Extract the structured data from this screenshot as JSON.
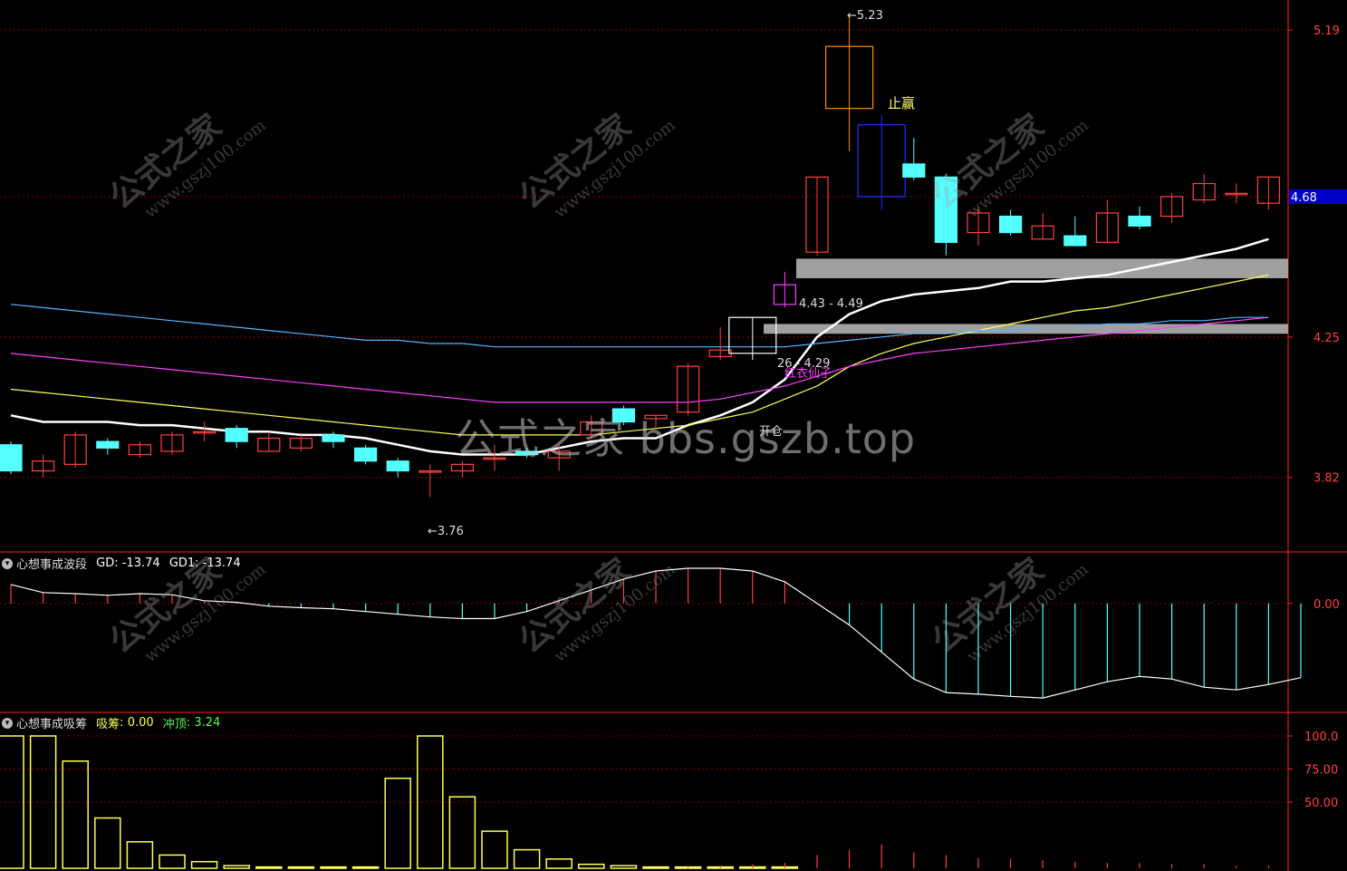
{
  "colors": {
    "up": "#ff4040",
    "down": "#54ffff",
    "ma_white": "#ffffff",
    "ma_yellow": "#ffff54",
    "ma_magenta": "#ff40ff",
    "ma_blue": "#54b4ff",
    "grid": "#8b0000",
    "axis": "#ff2020",
    "zone": "#a0a0a0",
    "osc_up": "#ff4040",
    "osc_down": "#54ffff",
    "bar_yellow": "#ffff54",
    "bar_red": "#ff4040"
  },
  "main_axis": {
    "ticks": [
      "5.19",
      "4.25",
      "3.82"
    ],
    "current_price": "4.68",
    "range": [
      3.6,
      5.26
    ]
  },
  "annotations": {
    "high": "5.23",
    "low": "3.76",
    "zone_upper": "4.43 - 4.49",
    "zone_lower": "26 - 4.29",
    "stop_profit": "止赢",
    "red_candle_label": "红衣仙子",
    "open_label": "开仓"
  },
  "watermark": {
    "main": "公式之家 bbs.gszb.top",
    "cn": "公式之家",
    "url": "www.gszj100.com"
  },
  "panel2": {
    "title": "心想事成波段",
    "gd_label": "GD: -13.74",
    "gd1_label": "GD1: -13.74",
    "zero_label": "0.00"
  },
  "panel3": {
    "title": "心想事成吸筹",
    "absorb_label": "吸筹",
    "absorb_value": "0.00",
    "top_label": "冲顶",
    "top_value": "3.24",
    "ticks": [
      "100.0",
      "75.00",
      "50.00"
    ]
  },
  "chart_data": [
    {
      "type": "candlestick",
      "title": "",
      "ylim": [
        3.6,
        5.26
      ],
      "candles": [
        {
          "o": 3.92,
          "c": 3.84,
          "h": 3.93,
          "l": 3.83
        },
        {
          "o": 3.84,
          "c": 3.87,
          "h": 3.89,
          "l": 3.82
        },
        {
          "o": 3.86,
          "c": 3.95,
          "h": 3.96,
          "l": 3.85
        },
        {
          "o": 3.93,
          "c": 3.91,
          "h": 3.94,
          "l": 3.89
        },
        {
          "o": 3.89,
          "c": 3.92,
          "h": 3.93,
          "l": 3.88
        },
        {
          "o": 3.9,
          "c": 3.95,
          "h": 3.96,
          "l": 3.89
        },
        {
          "o": 3.96,
          "c": 3.96,
          "h": 3.99,
          "l": 3.93
        },
        {
          "o": 3.97,
          "c": 3.93,
          "h": 3.98,
          "l": 3.91
        },
        {
          "o": 3.9,
          "c": 3.94,
          "h": 3.96,
          "l": 3.9
        },
        {
          "o": 3.91,
          "c": 3.94,
          "h": 3.95,
          "l": 3.9
        },
        {
          "o": 3.95,
          "c": 3.93,
          "h": 3.96,
          "l": 3.91
        },
        {
          "o": 3.91,
          "c": 3.87,
          "h": 3.92,
          "l": 3.86
        },
        {
          "o": 3.87,
          "c": 3.84,
          "h": 3.88,
          "l": 3.82
        },
        {
          "o": 3.84,
          "c": 3.84,
          "h": 3.86,
          "l": 3.76
        },
        {
          "o": 3.84,
          "c": 3.86,
          "h": 3.87,
          "l": 3.82
        },
        {
          "o": 3.88,
          "c": 3.88,
          "h": 3.92,
          "l": 3.84
        },
        {
          "o": 3.9,
          "c": 3.89,
          "h": 3.91,
          "l": 3.88
        },
        {
          "o": 3.88,
          "c": 3.9,
          "h": 3.92,
          "l": 3.84
        },
        {
          "o": 3.95,
          "c": 3.99,
          "h": 4.01,
          "l": 3.94
        },
        {
          "o": 4.03,
          "c": 3.99,
          "h": 4.04,
          "l": 3.98
        },
        {
          "o": 4.0,
          "c": 4.01,
          "h": 4.01,
          "l": 3.97
        },
        {
          "o": 4.02,
          "c": 4.16,
          "h": 4.17,
          "l": 4.01
        },
        {
          "o": 4.19,
          "c": 4.21,
          "h": 4.28,
          "l": 4.18
        },
        {
          "o": 4.2,
          "c": 4.31,
          "h": 4.31,
          "l": 4.18
        },
        {
          "o": 4.35,
          "c": 4.41,
          "h": 4.45,
          "l": 4.34
        },
        {
          "o": 4.51,
          "c": 4.74,
          "h": 4.74,
          "l": 4.5
        },
        {
          "o": 4.95,
          "c": 5.14,
          "h": 5.23,
          "l": 4.82
        },
        {
          "o": 4.68,
          "c": 4.9,
          "h": 4.93,
          "l": 4.64
        },
        {
          "o": 4.78,
          "c": 4.74,
          "h": 4.86,
          "l": 4.73
        },
        {
          "o": 4.74,
          "c": 4.54,
          "h": 4.75,
          "l": 4.5
        },
        {
          "o": 4.57,
          "c": 4.63,
          "h": 4.65,
          "l": 4.53
        },
        {
          "o": 4.62,
          "c": 4.57,
          "h": 4.64,
          "l": 4.56
        },
        {
          "o": 4.55,
          "c": 4.59,
          "h": 4.63,
          "l": 4.55
        },
        {
          "o": 4.56,
          "c": 4.53,
          "h": 4.62,
          "l": 4.53
        },
        {
          "o": 4.54,
          "c": 4.63,
          "h": 4.67,
          "l": 4.54
        },
        {
          "o": 4.62,
          "c": 4.59,
          "h": 4.65,
          "l": 4.58
        },
        {
          "o": 4.62,
          "c": 4.68,
          "h": 4.69,
          "l": 4.6
        },
        {
          "o": 4.67,
          "c": 4.72,
          "h": 4.75,
          "l": 4.66
        },
        {
          "o": 4.69,
          "c": 4.69,
          "h": 4.72,
          "l": 4.66
        },
        {
          "o": 4.66,
          "c": 4.74,
          "h": 4.74,
          "l": 4.64
        }
      ],
      "series": [
        {
          "values": [
            4.01,
            3.99,
            3.99,
            3.99,
            3.98,
            3.98,
            3.97,
            3.96,
            3.96,
            3.95,
            3.95,
            3.94,
            3.92,
            3.9,
            3.89,
            3.89,
            3.89,
            3.91,
            3.93,
            3.94,
            3.94,
            3.98,
            4.01,
            4.05,
            4.12,
            4.25,
            4.32,
            4.36,
            4.38,
            4.39,
            4.4,
            4.42,
            4.42,
            4.43,
            4.44,
            4.46,
            4.48,
            4.5,
            4.52,
            4.55
          ]
        },
        {
          "values": [
            4.09,
            4.08,
            4.07,
            4.06,
            4.05,
            4.04,
            4.03,
            4.02,
            4.01,
            4.0,
            3.99,
            3.98,
            3.97,
            3.96,
            3.95,
            3.95,
            3.95,
            3.95,
            3.95,
            3.96,
            3.97,
            3.98,
            4.0,
            4.02,
            4.06,
            4.1,
            4.16,
            4.2,
            4.23,
            4.25,
            4.27,
            4.29,
            4.31,
            4.33,
            4.34,
            4.36,
            4.38,
            4.4,
            4.42,
            4.44
          ]
        },
        {
          "values": [
            4.2,
            4.19,
            4.18,
            4.17,
            4.16,
            4.15,
            4.14,
            4.13,
            4.12,
            4.11,
            4.1,
            4.09,
            4.08,
            4.07,
            4.06,
            4.05,
            4.05,
            4.05,
            4.05,
            4.05,
            4.05,
            4.05,
            4.06,
            4.08,
            4.1,
            4.13,
            4.16,
            4.18,
            4.2,
            4.21,
            4.22,
            4.23,
            4.24,
            4.25,
            4.26,
            4.27,
            4.28,
            4.29,
            4.3,
            4.31
          ]
        },
        {
          "values": [
            4.35,
            4.34,
            4.33,
            4.32,
            4.31,
            4.3,
            4.29,
            4.28,
            4.27,
            4.26,
            4.25,
            4.24,
            4.24,
            4.23,
            4.23,
            4.22,
            4.22,
            4.22,
            4.22,
            4.22,
            4.22,
            4.22,
            4.22,
            4.22,
            4.22,
            4.23,
            4.24,
            4.25,
            4.26,
            4.26,
            4.27,
            4.27,
            4.28,
            4.28,
            4.29,
            4.29,
            4.3,
            4.3,
            4.31,
            4.31
          ]
        }
      ],
      "zones": [
        [
          4.43,
          4.49
        ],
        [
          4.26,
          4.29
        ]
      ]
    },
    {
      "type": "bar",
      "title": "",
      "ylim": [
        -20,
        6
      ],
      "values": [
        3.5,
        2.0,
        1.8,
        1.5,
        1.8,
        1.6,
        0.5,
        0.2,
        -0.5,
        -0.8,
        -1.0,
        -1.5,
        -2.0,
        -2.5,
        -2.8,
        -2.8,
        -1.5,
        0.5,
        2.5,
        4.5,
        6.0,
        6.5,
        6.5,
        6.0,
        4.0,
        0.0,
        -4.0,
        -9.0,
        -14.0,
        -16.5,
        -16.8,
        -17.2,
        -17.5,
        -16.0,
        -14.5,
        -13.5,
        -14.0,
        -15.5,
        -16.0,
        -15.0,
        -13.74
      ]
    },
    {
      "type": "bar",
      "title": "",
      "ylim": [
        0,
        100
      ],
      "values": [
        100,
        100,
        81,
        38,
        20,
        10,
        5,
        2,
        1,
        1,
        1,
        1,
        68,
        100,
        54,
        28,
        14,
        7,
        3,
        2,
        1,
        1,
        1,
        1,
        1
      ],
      "red_values": [
        0,
        0,
        0,
        0,
        0,
        0,
        0,
        0,
        0,
        0,
        0,
        0,
        0,
        0,
        0,
        0,
        0,
        0,
        0,
        0,
        0,
        1,
        2,
        3,
        4,
        10,
        14,
        18,
        12,
        10,
        8,
        7,
        6,
        5,
        4,
        4,
        3,
        3,
        2,
        2
      ]
    }
  ]
}
